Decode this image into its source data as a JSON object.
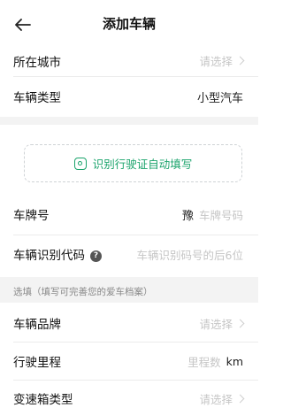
{
  "header": {
    "title": "添加车辆"
  },
  "rows": {
    "city": {
      "label": "所在城市",
      "placeholder": "请选择"
    },
    "vehicle_type": {
      "label": "车辆类型",
      "value": "小型汽车"
    },
    "ocr": {
      "label": "识别行驶证自动填写"
    },
    "plate": {
      "label": "车牌号",
      "province": "豫",
      "placeholder": "车牌号码"
    },
    "vin": {
      "label": "车辆识别代码",
      "placeholder": "车辆识别码号的后6位"
    },
    "optional_note": "选填（填写可完善您的爱车档案）",
    "brand": {
      "label": "车辆品牌",
      "placeholder": "请选择"
    },
    "mileage": {
      "label": "行驶里程",
      "placeholder": "里程数",
      "unit": "km"
    },
    "gearbox": {
      "label": "变速箱类型",
      "placeholder": "请选择"
    }
  },
  "colors": {
    "accent": "#1aa36b",
    "placeholder": "#c6c6c6",
    "gap_bg": "#f3f3f3"
  }
}
